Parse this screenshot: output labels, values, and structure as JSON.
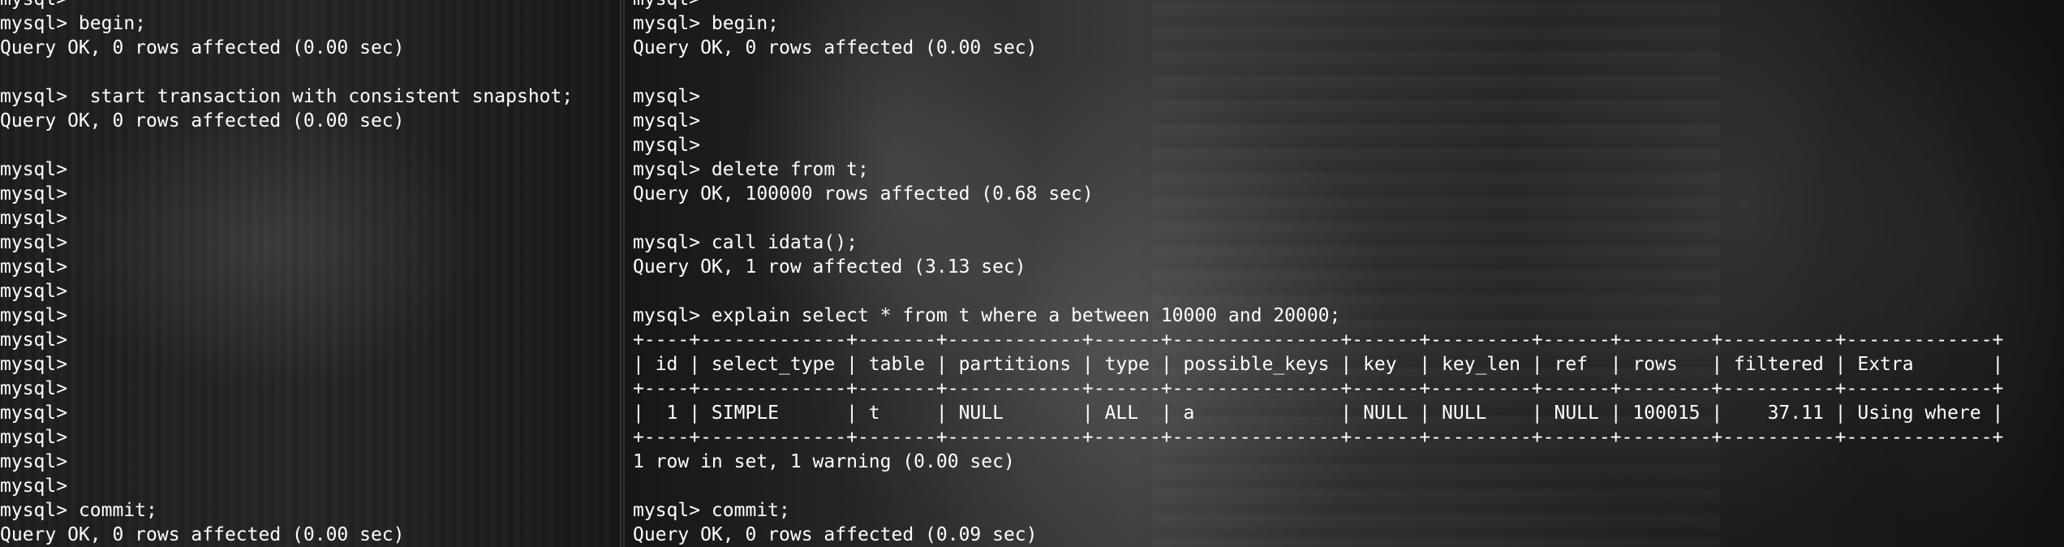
{
  "left_terminal": {
    "lines": [
      "mysql>",
      "mysql> begin;",
      "Query OK, 0 rows affected (0.00 sec)",
      "",
      "mysql>  start transaction with consistent snapshot;",
      "Query OK, 0 rows affected (0.00 sec)",
      "",
      "mysql>",
      "mysql>",
      "mysql>",
      "mysql>",
      "mysql>",
      "mysql>",
      "mysql>",
      "mysql>",
      "mysql>",
      "mysql>",
      "mysql>",
      "mysql>",
      "mysql>",
      "mysql>",
      "mysql> commit;",
      "Query OK, 0 rows affected (0.00 sec)"
    ]
  },
  "right_terminal": {
    "lines": [
      "mysql>",
      "mysql> begin;",
      "Query OK, 0 rows affected (0.00 sec)",
      "",
      "mysql>",
      "mysql>",
      "mysql>",
      "mysql> delete from t;",
      "Query OK, 100000 rows affected (0.68 sec)",
      "",
      "mysql> call idata();",
      "Query OK, 1 row affected (3.13 sec)",
      "",
      "mysql> explain select * from t where a between 10000 and 20000;",
      "+----+-------------+-------+------------+------+---------------+------+---------+------+--------+----------+-------------+",
      "| id | select_type | table | partitions | type | possible_keys | key  | key_len | ref  | rows   | filtered | Extra       |",
      "+----+-------------+-------+------------+------+---------------+------+---------+------+--------+----------+-------------+",
      "|  1 | SIMPLE      | t     | NULL       | ALL  | a             | NULL | NULL    | NULL | 100015 |    37.11 | Using where |",
      "+----+-------------+-------+------------+------+---------------+------+---------+------+--------+----------+-------------+",
      "1 row in set, 1 warning (0.00 sec)",
      "",
      "mysql> commit;",
      "Query OK, 0 rows affected (0.09 sec)"
    ]
  }
}
